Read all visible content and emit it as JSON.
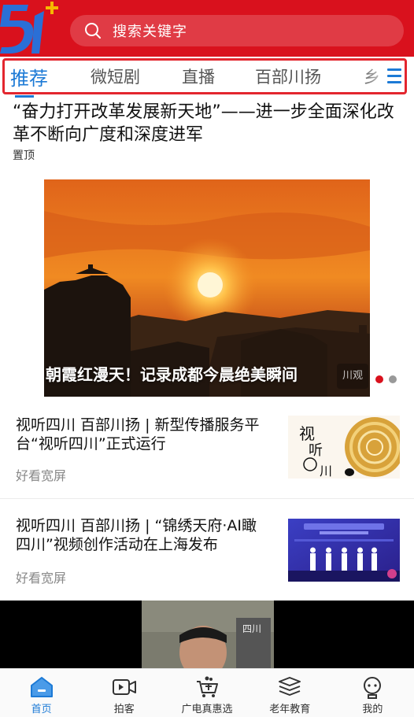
{
  "header": {
    "logo_text": "5",
    "search_placeholder": "搜索关键字"
  },
  "tabs": [
    {
      "label": "推荐",
      "active": true
    },
    {
      "label": "微短剧",
      "active": false
    },
    {
      "label": "直播",
      "active": false
    },
    {
      "label": "百部川扬",
      "active": false
    },
    {
      "label": "乡",
      "active": false
    }
  ],
  "pinned": {
    "headline": "“奋力打开改革发展新天地”——进一步全面深化改革不断向广度和深度进军",
    "tag": "置顶"
  },
  "banner": {
    "caption": "朝霞红漫天！记录成都今晨绝美瞬间",
    "watermark": "川观",
    "slide_count": 2,
    "active_slide": 1
  },
  "news": [
    {
      "title": "视听四川 百部川扬 | 新型传播服务平台“视听四川”正式运行",
      "source": "好看宽屏",
      "thumb_text": "视听四川"
    },
    {
      "title": "视听四川 百部川扬 | “锦绣天府·AI瞰四川”视频创作活动在上海发布",
      "source": "好看宽屏",
      "thumb_text": "“锦绣天府·AI瞰四川”"
    }
  ],
  "bottom_nav": [
    {
      "label": "首页",
      "icon": "home-icon",
      "active": true
    },
    {
      "label": "拍客",
      "icon": "video-camera-icon",
      "active": false
    },
    {
      "label": "广电真惠选",
      "icon": "shopping-cart-icon",
      "active": false
    },
    {
      "label": "老年教育",
      "icon": "books-icon",
      "active": false
    },
    {
      "label": "我的",
      "icon": "user-icon",
      "active": false
    }
  ],
  "colors": {
    "brand_red": "#d9111d",
    "accent_blue": "#1c7ad6"
  }
}
